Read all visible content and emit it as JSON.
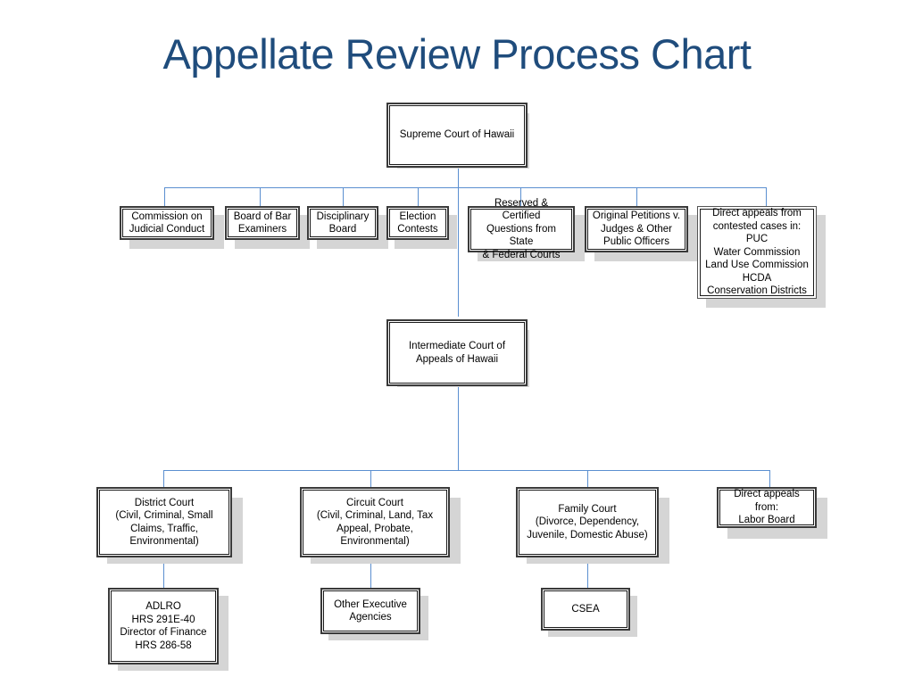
{
  "title": "Appellate Review Process Chart",
  "theme": {
    "title_color": "#1F4C7C",
    "connector_color": "#5B8FD0",
    "box_border_color": "#1a1a1a",
    "shadow_color": "#d5d5d5",
    "background": "#ffffff"
  },
  "chart_data": {
    "type": "diagram",
    "diagram_type": "organizational-flow-chart",
    "title": "Appellate Review Process Chart",
    "levels": [
      {
        "level": 1,
        "nodes": [
          "supreme-court"
        ]
      },
      {
        "level": 2,
        "nodes": [
          "commission-judicial-conduct",
          "board-bar-examiners",
          "disciplinary-board",
          "election-contests",
          "reserved-certified-questions",
          "original-petitions",
          "direct-appeals-contested"
        ]
      },
      {
        "level": 3,
        "nodes": [
          "intermediate-court"
        ]
      },
      {
        "level": 4,
        "nodes": [
          "district-court",
          "circuit-court",
          "family-court",
          "direct-appeals-labor"
        ]
      },
      {
        "level": 5,
        "nodes": [
          "adlro",
          "other-executive-agencies",
          "csea"
        ]
      }
    ],
    "edges": [
      [
        "supreme-court",
        "commission-judicial-conduct"
      ],
      [
        "supreme-court",
        "board-bar-examiners"
      ],
      [
        "supreme-court",
        "disciplinary-board"
      ],
      [
        "supreme-court",
        "election-contests"
      ],
      [
        "supreme-court",
        "reserved-certified-questions"
      ],
      [
        "supreme-court",
        "original-petitions"
      ],
      [
        "supreme-court",
        "direct-appeals-contested"
      ],
      [
        "supreme-court",
        "intermediate-court"
      ],
      [
        "intermediate-court",
        "district-court"
      ],
      [
        "intermediate-court",
        "circuit-court"
      ],
      [
        "intermediate-court",
        "family-court"
      ],
      [
        "intermediate-court",
        "direct-appeals-labor"
      ],
      [
        "district-court",
        "adlro"
      ],
      [
        "circuit-court",
        "other-executive-agencies"
      ],
      [
        "family-court",
        "csea"
      ]
    ]
  },
  "nodes": {
    "supreme_court": {
      "label": "Supreme Court of Hawaii"
    },
    "commission_judicial_conduct": {
      "label": "Commission on\nJudicial Conduct"
    },
    "board_bar_examiners": {
      "label": "Board of Bar\nExaminers"
    },
    "disciplinary_board": {
      "label": "Disciplinary\nBoard"
    },
    "election_contests": {
      "label": "Election\nContests"
    },
    "reserved_certified_questions": {
      "label": "Reserved & Certified\nQuestions from State\n& Federal Courts"
    },
    "original_petitions": {
      "label": "Original Petitions v.\nJudges & Other\nPublic Officers"
    },
    "direct_appeals_contested": {
      "label": "Direct appeals from\ncontested cases in:\nPUC\nWater Commission\nLand Use Commission\nHCDA\nConservation Districts"
    },
    "intermediate_court": {
      "label": "Intermediate Court of\nAppeals of Hawaii"
    },
    "district_court": {
      "label": "District Court\n(Civil, Criminal, Small\nClaims, Traffic,\nEnvironmental)"
    },
    "circuit_court": {
      "label": "Circuit Court\n(Civil, Criminal, Land, Tax\nAppeal, Probate,\nEnvironmental)"
    },
    "family_court": {
      "label": "Family Court\n(Divorce, Dependency,\nJuvenile, Domestic Abuse)"
    },
    "direct_appeals_labor": {
      "label": "Direct appeals from:\nLabor Board"
    },
    "adlro": {
      "label": "ADLRO\nHRS 291E-40\nDirector of Finance\nHRS 286-58"
    },
    "other_executive_agencies": {
      "label": "Other Executive\nAgencies"
    },
    "csea": {
      "label": "CSEA"
    }
  }
}
